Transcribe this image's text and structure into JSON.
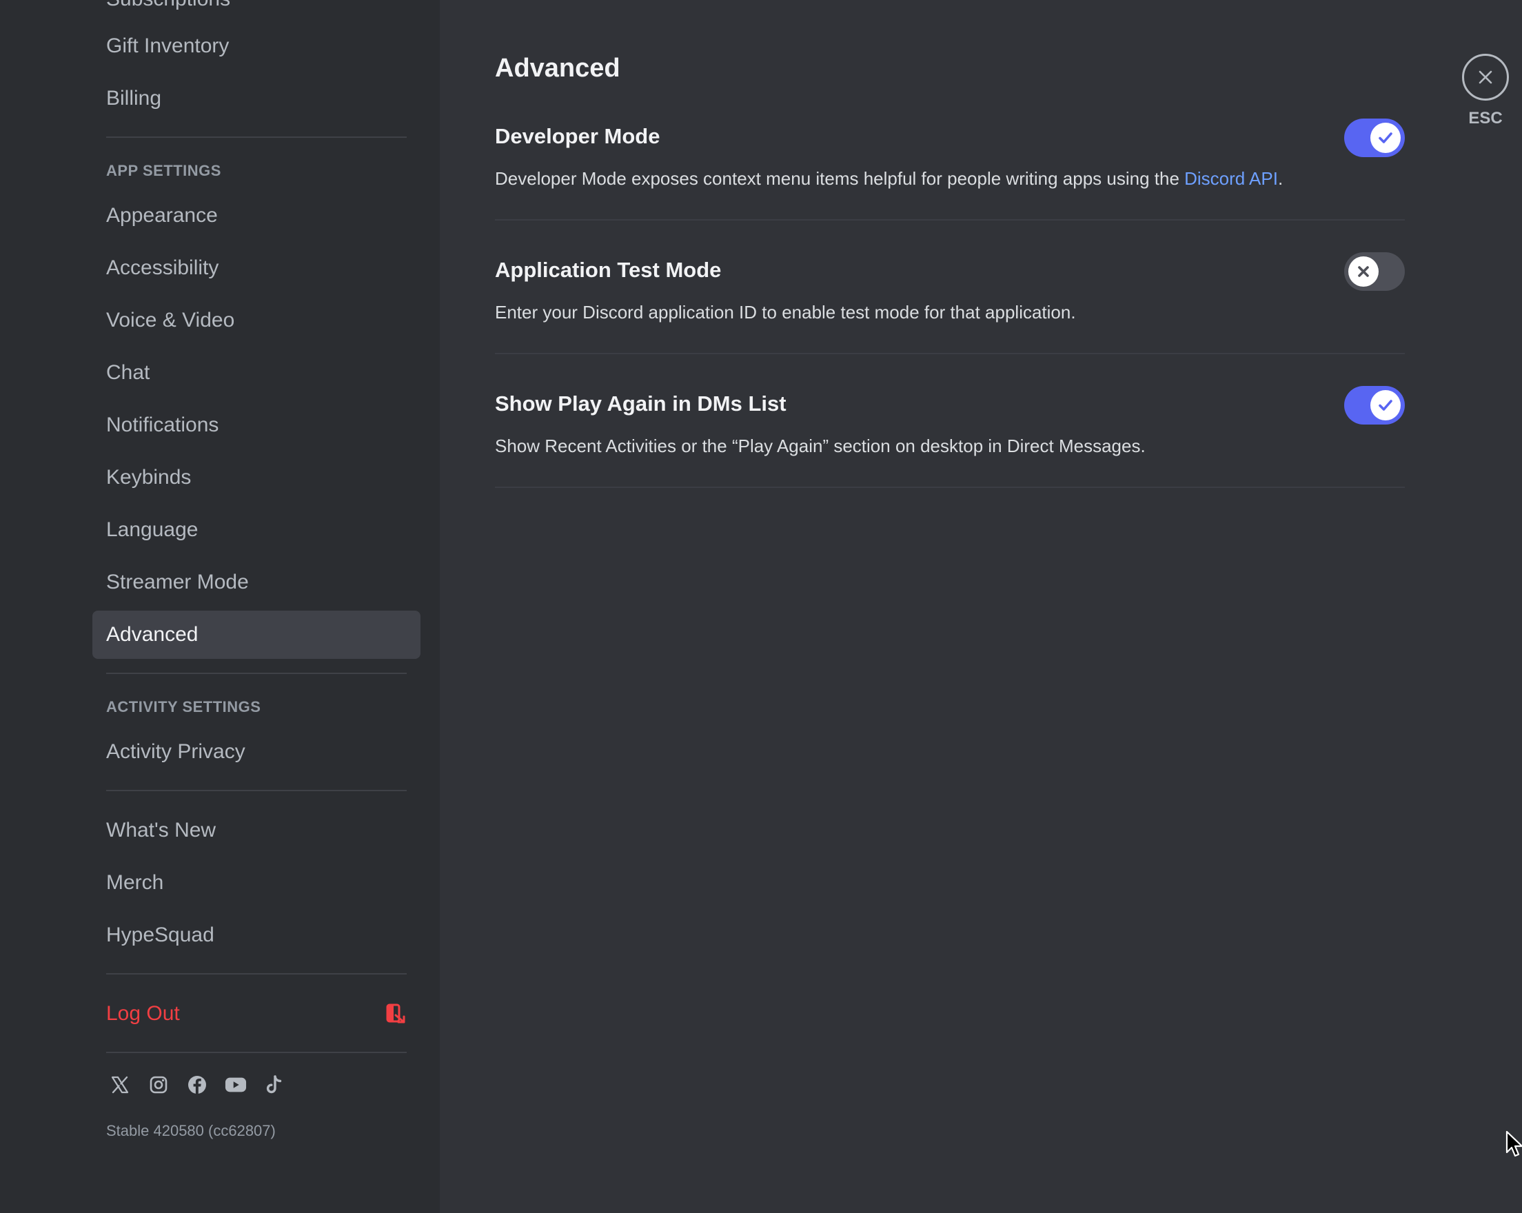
{
  "sidebar": {
    "top_cut_item": "Subscriptions",
    "user_items": [
      "Gift Inventory",
      "Billing"
    ],
    "app_settings_header": "APP SETTINGS",
    "app_items": [
      "Appearance",
      "Accessibility",
      "Voice & Video",
      "Chat",
      "Notifications",
      "Keybinds",
      "Language",
      "Streamer Mode",
      "Advanced"
    ],
    "selected_item": "Advanced",
    "activity_settings_header": "ACTIVITY SETTINGS",
    "activity_items": [
      "Activity Privacy"
    ],
    "misc_items": [
      "What's New",
      "Merch",
      "HypeSquad"
    ],
    "logout_label": "Log Out",
    "logout_icon": "logout-icon",
    "social_icons": [
      "x-icon",
      "instagram-icon",
      "facebook-icon",
      "youtube-icon",
      "tiktok-icon"
    ],
    "version": "Stable 420580 (cc62807)"
  },
  "main": {
    "title": "Advanced",
    "settings": [
      {
        "title": "Developer Mode",
        "description": "Developer Mode exposes context menu items helpful for people writing apps using the ",
        "link_text": "Discord API",
        "description_suffix": ".",
        "enabled": true
      },
      {
        "title": "Application Test Mode",
        "description": "Enter your Discord application ID to enable test mode for that application.",
        "enabled": false
      },
      {
        "title": "Show Play Again in DMs List",
        "description": "Show Recent Activities or the “Play Again” section on desktop in Direct Messages.",
        "enabled": true
      }
    ],
    "close_label": "ESC"
  },
  "colors": {
    "toggle_on": "#5865f2",
    "toggle_off": "#4e5058",
    "logout": "#f23f43",
    "link": "#6ea0ff",
    "sidebar_bg": "#2b2d31",
    "content_bg": "#313338",
    "selected_bg": "#404249"
  }
}
